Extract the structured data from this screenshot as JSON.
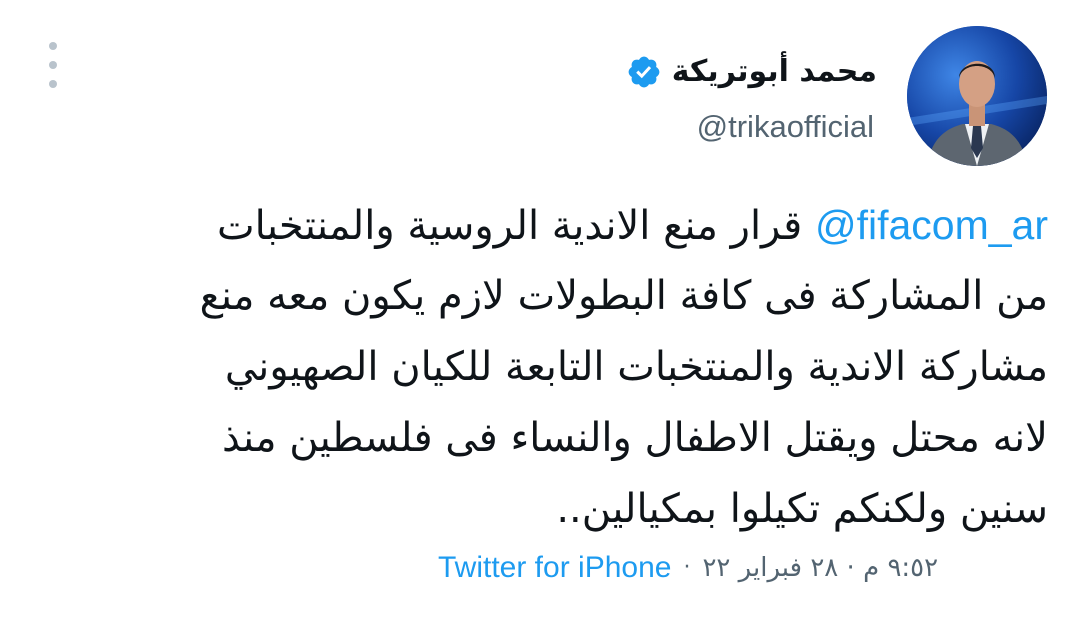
{
  "author": {
    "display_name": "محمد أبوتريكة",
    "handle": "@trikaofficial",
    "avatar_icon": "person-avatar",
    "verified_icon": "verified-badge-icon"
  },
  "menu": {
    "icon": "more-vertical-icon"
  },
  "tweet": {
    "mention": "@fifacom_ar",
    "lines": [
      "قرار منع الاندية الروسية والمنتخبات",
      "من المشاركة فى كافة البطولات لازم يكون معه منع",
      "مشاركة الاندية والمنتخبات التابعة للكيان الصهيوني",
      "لانه محتل ويقتل الاطفال والنساء فى فلسطين منذ",
      "سنين ولكنكم تكيلوا بمكيالين.."
    ]
  },
  "meta": {
    "timestamp": "٩:٥٢ م · ٢٨ فبراير ٢٢",
    "separator": "·",
    "source": "Twitter for iPhone"
  },
  "colors": {
    "link": "#1d9bf0",
    "secondary_text": "#536471",
    "primary_text": "#0f1419"
  }
}
